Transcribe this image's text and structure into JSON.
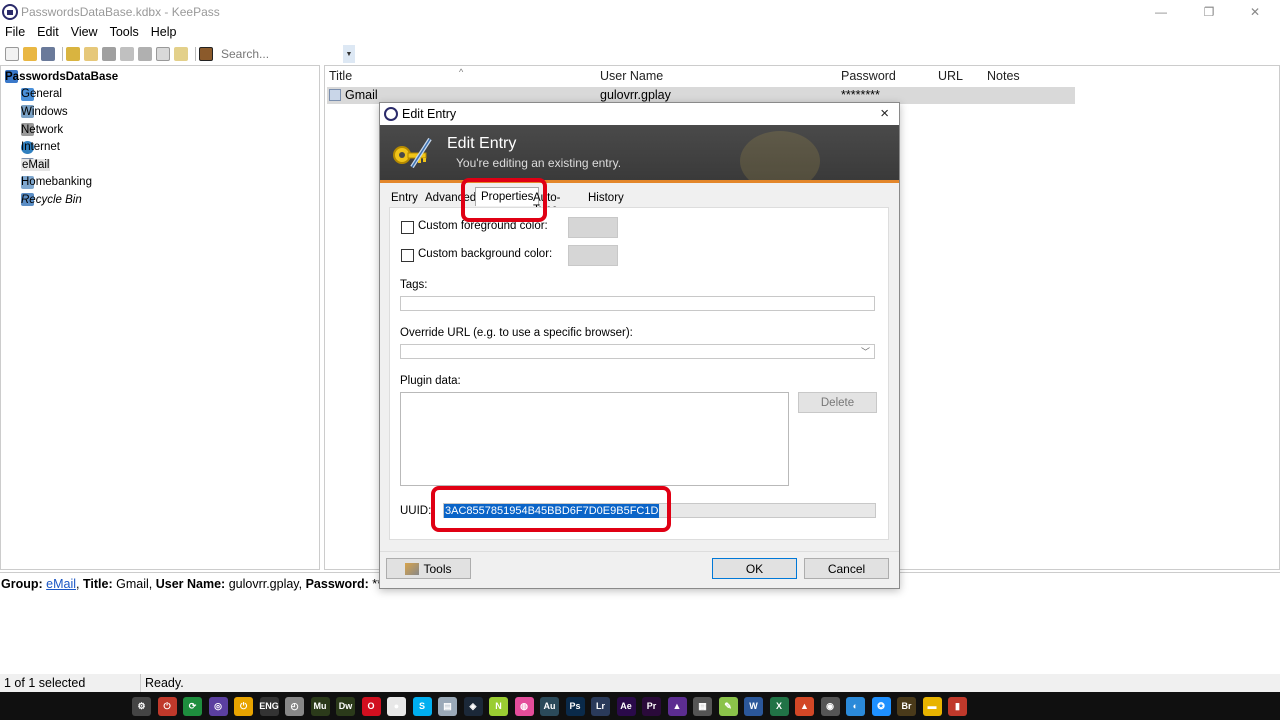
{
  "window": {
    "title": "PasswordsDataBase.kdbx - KeePass",
    "minimize": "—",
    "maximize": "❐",
    "close": "✕"
  },
  "menu": [
    "File",
    "Edit",
    "View",
    "Tools",
    "Help"
  ],
  "toolbar": {
    "search_placeholder": "Search..."
  },
  "tree": {
    "root": "PasswordsDataBase",
    "groups": [
      "General",
      "Windows",
      "Network",
      "Internet",
      "eMail",
      "Homebanking",
      "Recycle Bin"
    ],
    "selected": "eMail"
  },
  "list": {
    "columns": [
      "Title",
      "User Name",
      "Password",
      "URL",
      "Notes"
    ],
    "sort_indicator": "^",
    "row": {
      "title": "Gmail",
      "username": "gulovrr.gplay",
      "password": "********"
    }
  },
  "details": {
    "group_label": "Group:",
    "group_value": "eMail",
    "title_label": "Title:",
    "title_value": "Gmail,",
    "user_label": "User Name:",
    "user_value": "gulovrr.gplay,",
    "pass_label": "Password:",
    "pass_value": "*****"
  },
  "status": {
    "selected": "1 of 1 selected",
    "state": "Ready."
  },
  "dialog": {
    "title": "Edit Entry",
    "close": "×",
    "banner_title": "Edit Entry",
    "banner_subtitle": "You're editing an existing entry.",
    "tabs": [
      "Entry",
      "Advanced",
      "Properties",
      "Auto-Type",
      "History"
    ],
    "active_tab": "Properties",
    "fg_label": "Custom foreground color:",
    "bg_label": "Custom background color:",
    "tags_label": "Tags:",
    "override_label": "Override URL (e.g. to use a specific browser):",
    "plugin_label": "Plugin data:",
    "delete_button": "Delete",
    "uuid_label": "UUID:",
    "uuid_value": "3AC8557851954B45BBD6F7D0E9B5FC1D",
    "tools_button": "Tools",
    "ok_button": "OK",
    "cancel_button": "Cancel"
  },
  "colors": {
    "highlight": "#e00014",
    "selection": "#0a64c8",
    "banner_accent": "#e3862a"
  },
  "taskbar_icons": [
    "settings-icon",
    "opera-icon",
    "refresh-icon",
    "tor-icon",
    "power-icon",
    "eng-icon",
    "clock-icon",
    "mu-icon",
    "dw-icon",
    "opera-red-icon",
    "chrome-icon",
    "skype-icon",
    "notepad-icon",
    "steam-icon",
    "git-icon",
    "color-icon",
    "au-icon",
    "ps-icon",
    "lr-icon",
    "ae-icon",
    "pr-icon",
    "vs-icon",
    "grid-icon",
    "pen-icon",
    "word-icon",
    "excel-icon",
    "pdf-icon",
    "user-icon",
    "compass-icon",
    "gear2-icon",
    "br-icon",
    "folder-icon",
    "trash-icon"
  ],
  "taskbar_labels": [
    "⚙",
    "⏻",
    "⟳",
    "◎",
    "⏻",
    "ENG",
    "◴",
    "Mu",
    "Dw",
    "O",
    "●",
    "S",
    "▤",
    "◈",
    "N",
    "◍",
    "Au",
    "Ps",
    "Lr",
    "Ae",
    "Pr",
    "▲",
    "▦",
    "✎",
    "W",
    "X",
    "▲",
    "◉",
    "◐",
    "✪",
    "Br",
    "▬",
    "▮"
  ]
}
